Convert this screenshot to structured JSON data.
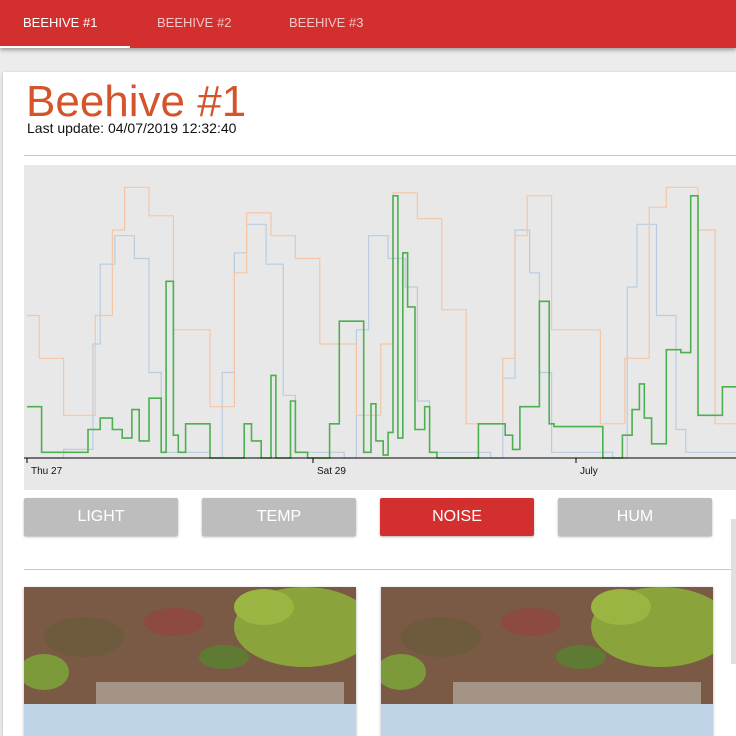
{
  "tabs": [
    {
      "label": "BEEHIVE #1",
      "active": true
    },
    {
      "label": "BEEHIVE #2",
      "active": false
    },
    {
      "label": "BEEHIVE #3",
      "active": false
    }
  ],
  "hive": {
    "title": "Beehive #1",
    "last_update": "Last update: 04/07/2019 12:32:40"
  },
  "buttons": [
    {
      "label": "LIGHT",
      "active": false
    },
    {
      "label": "TEMP",
      "active": false
    },
    {
      "label": "NOISE",
      "active": true
    },
    {
      "label": "HUM",
      "active": false
    }
  ],
  "colors": {
    "accent": "#d32f2f",
    "title": "#d4552b",
    "noise_series": "#4caf50",
    "temp_series": "#f5c6a5",
    "light_series": "#b9cde0",
    "button_inactive": "#bdbdbd"
  },
  "chart_data": {
    "type": "line",
    "step": true,
    "title": "",
    "xlabel": "",
    "ylabel": "",
    "x_ticks": [
      "Thu 27",
      "Sat 29",
      "July"
    ],
    "grid": false,
    "ylim": [
      0,
      100
    ],
    "series": [
      {
        "color": "#4caf50",
        "points": [
          [
            0,
            18
          ],
          [
            0.6,
            18
          ],
          [
            0.6,
            2
          ],
          [
            2.5,
            2
          ],
          [
            2.5,
            10
          ],
          [
            3,
            10
          ],
          [
            3,
            14
          ],
          [
            3.5,
            14
          ],
          [
            3.5,
            10
          ],
          [
            3.9,
            10
          ],
          [
            3.9,
            7
          ],
          [
            4.3,
            7
          ],
          [
            4.3,
            17
          ],
          [
            4.6,
            17
          ],
          [
            4.6,
            6
          ],
          [
            5,
            6
          ],
          [
            5,
            21
          ],
          [
            5.5,
            21
          ],
          [
            5.5,
            2
          ],
          [
            5.7,
            2
          ],
          [
            5.7,
            62
          ],
          [
            6,
            62
          ],
          [
            6,
            8
          ],
          [
            6.2,
            8
          ],
          [
            6.2,
            2
          ],
          [
            6.5,
            2
          ],
          [
            6.5,
            12
          ],
          [
            7.5,
            12
          ],
          [
            7.5,
            0
          ],
          [
            8.9,
            0
          ],
          [
            8.9,
            12
          ],
          [
            9.2,
            12
          ],
          [
            9.2,
            6
          ],
          [
            9.6,
            6
          ],
          [
            9.6,
            0
          ],
          [
            10,
            0
          ],
          [
            10,
            29
          ],
          [
            10.2,
            29
          ],
          [
            10.2,
            0
          ],
          [
            10.8,
            0
          ],
          [
            10.8,
            20
          ],
          [
            11,
            20
          ],
          [
            11,
            2
          ],
          [
            11.5,
            2
          ],
          [
            11.5,
            0
          ],
          [
            12.4,
            0
          ],
          [
            12.4,
            12
          ],
          [
            12.8,
            12
          ],
          [
            12.8,
            48
          ],
          [
            13.8,
            48
          ],
          [
            13.8,
            2
          ],
          [
            14.1,
            2
          ],
          [
            14.1,
            19
          ],
          [
            14.3,
            19
          ],
          [
            14.3,
            6
          ],
          [
            14.6,
            6
          ],
          [
            14.6,
            1
          ],
          [
            14.8,
            1
          ],
          [
            14.8,
            9
          ],
          [
            15,
            9
          ],
          [
            15,
            92
          ],
          [
            15.2,
            92
          ],
          [
            15.2,
            7
          ],
          [
            15.4,
            7
          ],
          [
            15.4,
            72
          ],
          [
            15.6,
            72
          ],
          [
            15.6,
            53
          ],
          [
            15.9,
            53
          ],
          [
            15.9,
            10
          ],
          [
            16.3,
            10
          ],
          [
            16.3,
            18
          ],
          [
            16.5,
            18
          ],
          [
            16.5,
            2
          ],
          [
            16.8,
            2
          ],
          [
            16.8,
            0
          ],
          [
            18.5,
            0
          ],
          [
            18.5,
            12
          ],
          [
            19.6,
            12
          ],
          [
            19.6,
            8
          ],
          [
            19.9,
            8
          ],
          [
            19.9,
            3
          ],
          [
            20.2,
            3
          ],
          [
            20.2,
            18
          ],
          [
            21,
            18
          ],
          [
            21,
            55
          ],
          [
            21.4,
            55
          ],
          [
            21.4,
            12
          ],
          [
            21.6,
            12
          ],
          [
            21.6,
            11
          ],
          [
            23.6,
            11
          ],
          [
            23.6,
            0
          ],
          [
            24.4,
            0
          ],
          [
            24.4,
            8
          ],
          [
            24.8,
            8
          ],
          [
            24.8,
            17
          ],
          [
            25.1,
            17
          ],
          [
            25.1,
            26
          ],
          [
            25.3,
            26
          ],
          [
            25.3,
            14
          ],
          [
            25.6,
            14
          ],
          [
            25.6,
            5
          ],
          [
            26.2,
            5
          ],
          [
            26.2,
            38
          ],
          [
            26.8,
            38
          ],
          [
            26.8,
            37
          ],
          [
            27.2,
            37
          ],
          [
            27.2,
            92
          ],
          [
            27.5,
            92
          ],
          [
            27.5,
            15
          ],
          [
            28.5,
            15
          ],
          [
            28.5,
            25
          ],
          [
            29.5,
            25
          ]
        ]
      },
      {
        "color": "#f5c6a5",
        "points": [
          [
            0,
            50
          ],
          [
            0.5,
            50
          ],
          [
            0.5,
            35
          ],
          [
            1.5,
            35
          ],
          [
            1.5,
            15
          ],
          [
            2.8,
            15
          ],
          [
            2.8,
            50
          ],
          [
            3.5,
            50
          ],
          [
            3.5,
            80
          ],
          [
            4,
            80
          ],
          [
            4,
            95
          ],
          [
            5,
            95
          ],
          [
            5,
            85
          ],
          [
            6,
            85
          ],
          [
            6,
            45
          ],
          [
            7.5,
            45
          ],
          [
            7.5,
            18
          ],
          [
            8.5,
            18
          ],
          [
            8.5,
            65
          ],
          [
            9,
            65
          ],
          [
            9,
            86
          ],
          [
            10,
            86
          ],
          [
            10,
            78
          ],
          [
            11,
            78
          ],
          [
            11,
            70
          ],
          [
            12,
            70
          ],
          [
            12,
            40
          ],
          [
            13.5,
            40
          ],
          [
            13.5,
            15
          ],
          [
            14.5,
            15
          ],
          [
            14.5,
            40
          ],
          [
            15,
            40
          ],
          [
            15,
            93
          ],
          [
            16,
            93
          ],
          [
            16,
            84
          ],
          [
            17,
            84
          ],
          [
            17,
            52
          ],
          [
            18,
            52
          ],
          [
            18,
            12
          ],
          [
            19.5,
            12
          ],
          [
            19.5,
            35
          ],
          [
            20,
            35
          ],
          [
            20,
            78
          ],
          [
            20.5,
            78
          ],
          [
            20.5,
            92
          ],
          [
            21.5,
            92
          ],
          [
            21.5,
            45
          ],
          [
            23.5,
            45
          ],
          [
            23.5,
            12
          ],
          [
            24.5,
            12
          ],
          [
            24.5,
            35
          ],
          [
            25.5,
            35
          ],
          [
            25.5,
            88
          ],
          [
            26.2,
            88
          ],
          [
            26.2,
            95
          ],
          [
            27.5,
            95
          ],
          [
            27.5,
            80
          ],
          [
            28.2,
            80
          ],
          [
            28.2,
            12
          ],
          [
            29.5,
            12
          ]
        ]
      },
      {
        "color": "#b9cde0",
        "points": [
          [
            0,
            0
          ],
          [
            1.5,
            0
          ],
          [
            1.5,
            3
          ],
          [
            2.7,
            3
          ],
          [
            2.7,
            40
          ],
          [
            3,
            40
          ],
          [
            3,
            68
          ],
          [
            3.6,
            68
          ],
          [
            3.6,
            78
          ],
          [
            4.4,
            78
          ],
          [
            4.4,
            70
          ],
          [
            5,
            70
          ],
          [
            5,
            30
          ],
          [
            5.5,
            30
          ],
          [
            5.5,
            2
          ],
          [
            7.5,
            2
          ],
          [
            7.5,
            0
          ],
          [
            8,
            0
          ],
          [
            8,
            30
          ],
          [
            8.5,
            30
          ],
          [
            8.5,
            72
          ],
          [
            9,
            72
          ],
          [
            9,
            82
          ],
          [
            9.8,
            82
          ],
          [
            9.8,
            68
          ],
          [
            10.5,
            68
          ],
          [
            10.5,
            22
          ],
          [
            11,
            22
          ],
          [
            11,
            2
          ],
          [
            13,
            2
          ],
          [
            13,
            0
          ],
          [
            13.5,
            0
          ],
          [
            13.5,
            45
          ],
          [
            14,
            45
          ],
          [
            14,
            78
          ],
          [
            14.8,
            78
          ],
          [
            14.8,
            70
          ],
          [
            15.5,
            70
          ],
          [
            15.5,
            60
          ],
          [
            16,
            60
          ],
          [
            16,
            20
          ],
          [
            16.5,
            20
          ],
          [
            16.5,
            2
          ],
          [
            19,
            2
          ],
          [
            19,
            0
          ],
          [
            19.5,
            0
          ],
          [
            19.5,
            28
          ],
          [
            20,
            28
          ],
          [
            20,
            80
          ],
          [
            20.6,
            80
          ],
          [
            20.6,
            65
          ],
          [
            21,
            65
          ],
          [
            21,
            30
          ],
          [
            21.5,
            30
          ],
          [
            21.5,
            2
          ],
          [
            24,
            2
          ],
          [
            24,
            0
          ],
          [
            24.6,
            0
          ],
          [
            24.6,
            60
          ],
          [
            25,
            60
          ],
          [
            25,
            82
          ],
          [
            25.8,
            82
          ],
          [
            25.8,
            50
          ],
          [
            26.6,
            50
          ],
          [
            26.6,
            10
          ],
          [
            27,
            10
          ],
          [
            27,
            2
          ],
          [
            29.5,
            2
          ]
        ]
      }
    ]
  }
}
